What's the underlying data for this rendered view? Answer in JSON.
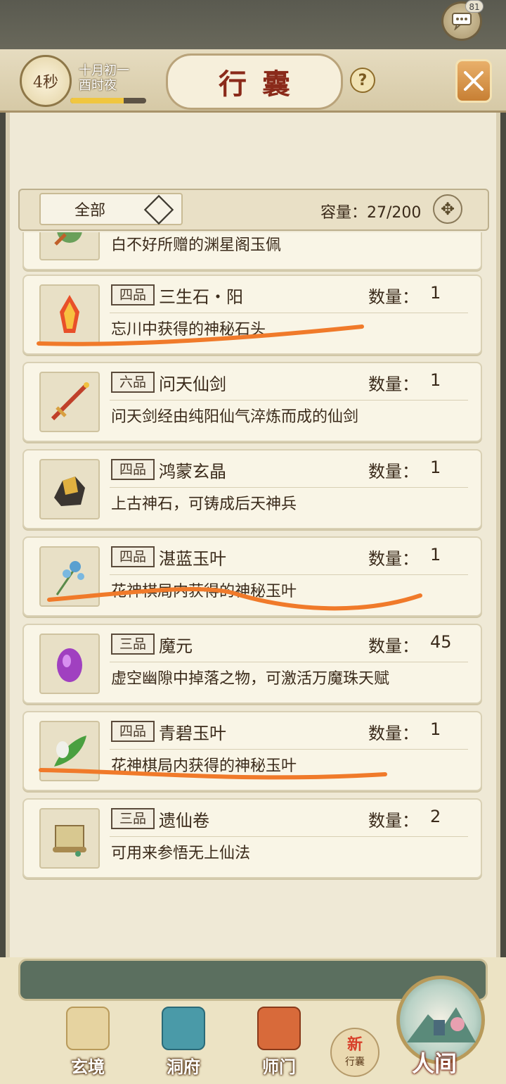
{
  "chat": {
    "badge": "81",
    "icon": "chat-bubble-icon"
  },
  "header": {
    "timer": "4秒",
    "date_line1": "十月初一",
    "date_line2": "酉时夜",
    "time_progress": 0.7,
    "title": "行囊",
    "help": "?",
    "close_icon": "close-x-icon"
  },
  "filter": {
    "selected": "全部",
    "capacity_label": "容量：",
    "capacity_value": "27/200"
  },
  "items": [
    {
      "grade": "",
      "name": "",
      "qty_label": "",
      "qty": "",
      "desc": "白不好所赠的渊星阁玉佩",
      "icon": "jade-pendant-icon",
      "icon_color": "#6aa05a"
    },
    {
      "grade": "四品",
      "name": "三生石・阳",
      "qty_label": "数量：",
      "qty": "1",
      "desc": "忘川中获得的神秘石头",
      "icon": "fire-crystal-icon",
      "icon_color": "#e8502a"
    },
    {
      "grade": "六品",
      "name": "问天仙剑",
      "qty_label": "数量：",
      "qty": "1",
      "desc": "问天剑经由纯阳仙气淬炼而成的仙剑",
      "icon": "sword-icon",
      "icon_color": "#c0402a"
    },
    {
      "grade": "四品",
      "name": "鸿蒙玄晶",
      "qty_label": "数量：",
      "qty": "1",
      "desc": "上古神石，可铸成后天神兵",
      "icon": "gold-ore-icon",
      "icon_color": "#c89a3a"
    },
    {
      "grade": "四品",
      "name": "湛蓝玉叶",
      "qty_label": "数量：",
      "qty": "1",
      "desc": "花神棋局内获得的神秘玉叶",
      "icon": "blue-flower-icon",
      "icon_color": "#5aa0d0"
    },
    {
      "grade": "三品",
      "name": "魔元",
      "qty_label": "数量：",
      "qty": "45",
      "desc": "虚空幽隙中掉落之物，可激活万魔珠天赋",
      "icon": "purple-gem-icon",
      "icon_color": "#a040c0"
    },
    {
      "grade": "四品",
      "name": "青碧玉叶",
      "qty_label": "数量：",
      "qty": "1",
      "desc": "花神棋局内获得的神秘玉叶",
      "icon": "green-leaf-icon",
      "icon_color": "#4aa040"
    },
    {
      "grade": "三品",
      "name": "遗仙卷",
      "qty_label": "数量：",
      "qty": "2",
      "desc": "可用来参悟无上仙法",
      "icon": "scroll-icon",
      "icon_color": "#c8b070"
    }
  ],
  "nav": {
    "xuanjing": "玄境",
    "dongfu": "洞府",
    "shimen": "师门",
    "new_tag": "新",
    "xingnang": "行囊",
    "renjian": "人间"
  },
  "colors": {
    "annotation": "#f07a2a",
    "panel_bg": "#efe9d6",
    "title_red": "#8a2a1a"
  }
}
